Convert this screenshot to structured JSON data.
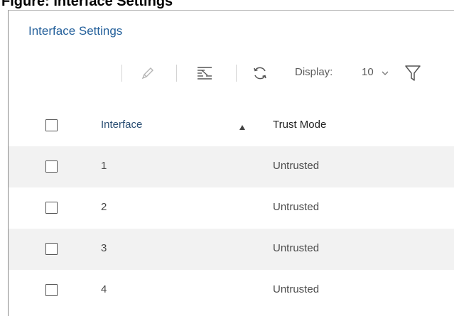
{
  "caption": "Figure: Interface Settings",
  "panel": {
    "title": "Interface Settings"
  },
  "toolbar": {
    "icons": [
      "edit-icon",
      "column-config-icon",
      "refresh-icon",
      "chevron-down-icon",
      "filter-icon"
    ],
    "display_label": "Display:",
    "display_value": "10"
  },
  "table": {
    "headers": {
      "interface": "Interface",
      "trust_mode": "Trust Mode"
    },
    "sort": "ascending",
    "rows": [
      {
        "interface": "1",
        "trust_mode": "Untrusted"
      },
      {
        "interface": "2",
        "trust_mode": "Untrusted"
      },
      {
        "interface": "3",
        "trust_mode": "Untrusted"
      },
      {
        "interface": "4",
        "trust_mode": "Untrusted"
      }
    ]
  },
  "colors": {
    "title": "#24609b",
    "header": "#2a4e73",
    "row_alt": "#f2f2f2"
  }
}
